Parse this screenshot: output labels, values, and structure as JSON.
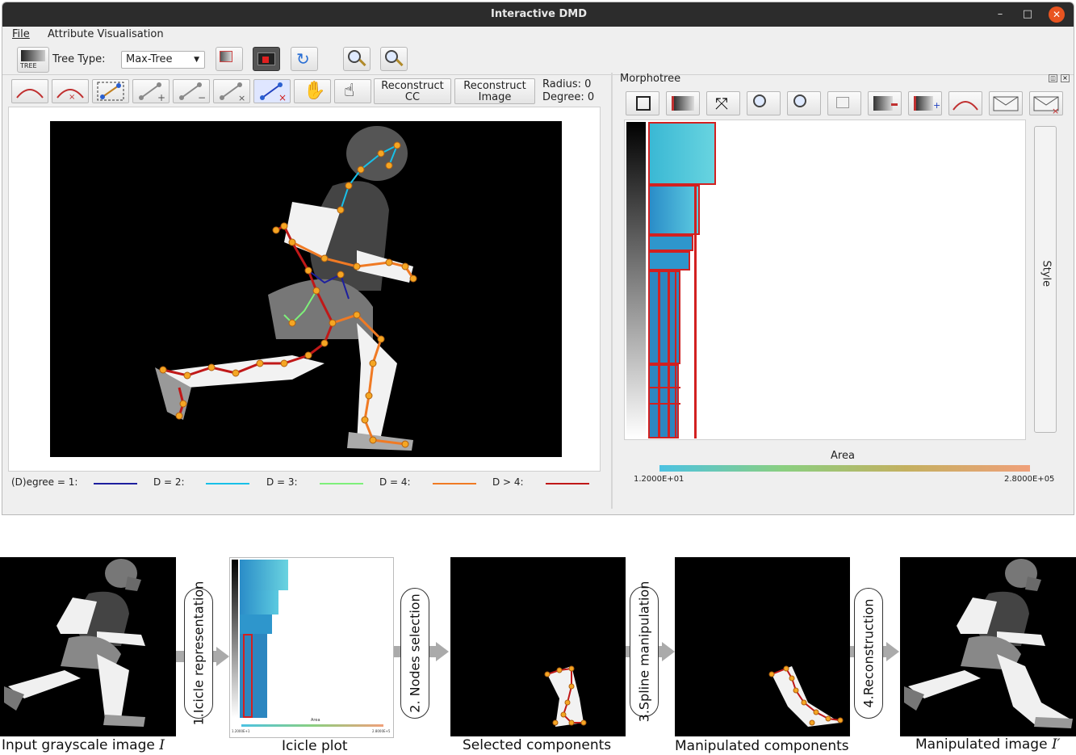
{
  "window": {
    "title": "Interactive DMD",
    "minimize": "–",
    "maximize": "□",
    "close": "✕"
  },
  "menu": {
    "file": "File",
    "attr": "Attribute Visualisation"
  },
  "toolbar": {
    "tree_label": "TREE",
    "tree_type_label": "Tree Type:",
    "tree_type_value": "Max-Tree"
  },
  "editor": {
    "reconstruct_cc": "Reconstruct CC",
    "reconstruct_cc_line1": "Reconstruct",
    "reconstruct_cc_line2": "CC",
    "reconstruct_image_line1": "Reconstruct",
    "reconstruct_image_line2": "Image",
    "radius": "Radius: 0",
    "degree": "Degree: 0"
  },
  "legend": {
    "d1": "(D)egree = 1:",
    "d2": "D = 2:",
    "d3": "D = 3:",
    "d4": "D = 4:",
    "d5": "D > 4:",
    "colors": [
      "#1d1f9e",
      "#18c0e8",
      "#7ef07a",
      "#f07a24",
      "#c01818"
    ]
  },
  "morphotree": {
    "title": "Morphotree",
    "style_tab": "Style",
    "attr_name": "Area",
    "scale_min": "1.2000E+01",
    "scale_max": "2.8000E+05"
  },
  "pipeline": {
    "input_label": "Input grayscale image",
    "input_symbol": "I",
    "icicle_label": "Icicle plot",
    "selected_label": "Selected components",
    "manipulated_label": "Manipulated components",
    "output_label": "Manipulated image",
    "output_symbol": "I′",
    "steps": [
      "1.Icicle representation",
      "2. Nodes selection",
      "3.Spline manipulation",
      "4.Reconstruction"
    ],
    "mini_area": "Area",
    "mini_min": "1.2000E+1",
    "mini_max": "2.8000E+5"
  }
}
